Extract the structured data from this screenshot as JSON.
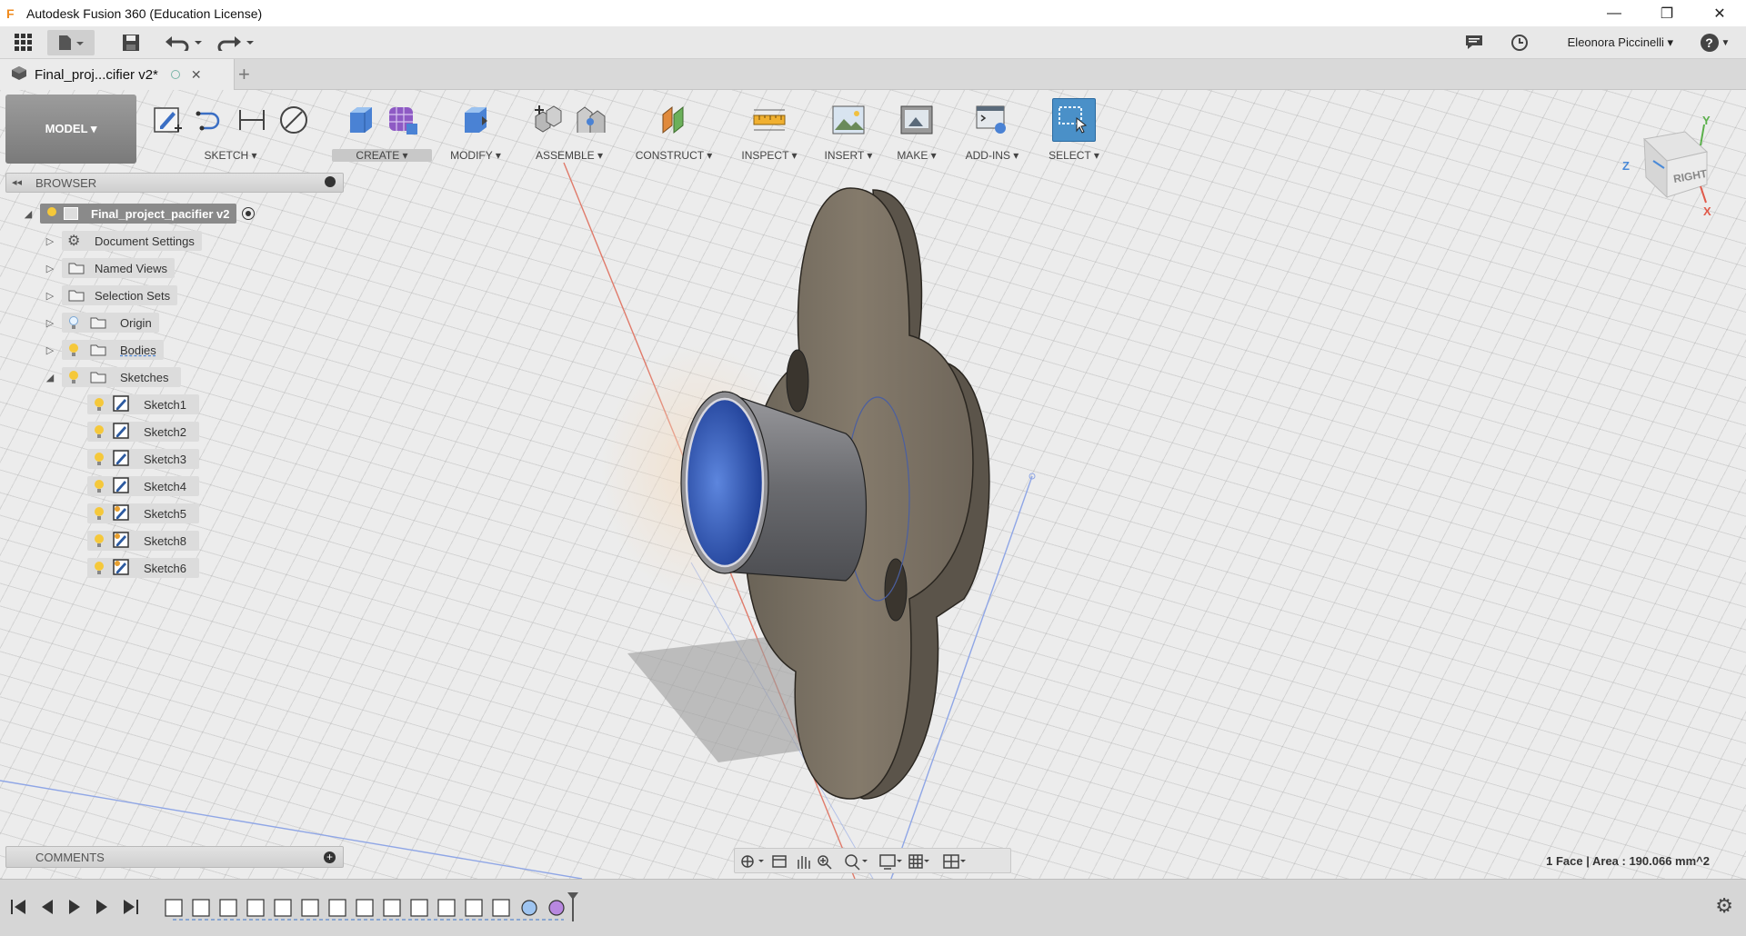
{
  "window": {
    "title": "Autodesk Fusion 360 (Education License)",
    "minimize": "—",
    "maximize": "❐",
    "close": "✕"
  },
  "appbar": {
    "user": "Eleonora Piccinelli ▾",
    "help": "?"
  },
  "doc_tab": {
    "name": "Final_proj...cifier v2*",
    "close": "✕",
    "add": "+"
  },
  "toolbar": {
    "workspace": "MODEL ▾",
    "groups": [
      {
        "label": "SKETCH ▾"
      },
      {
        "label": "CREATE ▾"
      },
      {
        "label": "MODIFY ▾"
      },
      {
        "label": "ASSEMBLE ▾"
      },
      {
        "label": "CONSTRUCT ▾"
      },
      {
        "label": "INSPECT ▾"
      },
      {
        "label": "INSERT ▾"
      },
      {
        "label": "MAKE ▾"
      },
      {
        "label": "ADD-INS ▾"
      },
      {
        "label": "SELECT ▾"
      }
    ]
  },
  "browser": {
    "title": "BROWSER",
    "root": "Final_project_pacifier v2",
    "items": [
      {
        "label": "Document Settings"
      },
      {
        "label": "Named Views"
      },
      {
        "label": "Selection Sets"
      },
      {
        "label": "Origin"
      },
      {
        "label": "Bodies"
      },
      {
        "label": "Sketches"
      }
    ],
    "sketches": [
      {
        "label": "Sketch1"
      },
      {
        "label": "Sketch2"
      },
      {
        "label": "Sketch3"
      },
      {
        "label": "Sketch4"
      },
      {
        "label": "Sketch5"
      },
      {
        "label": "Sketch8"
      },
      {
        "label": "Sketch6"
      }
    ]
  },
  "viewcube": {
    "face": "RIGHT",
    "axis_z": "Z",
    "axis_y": "Y",
    "axis_x": "X"
  },
  "comments": {
    "title": "COMMENTS"
  },
  "status": {
    "text": "1 Face | Area : 190.066 mm^2"
  },
  "colors": {
    "model_body": "#7a7163",
    "cavity": "#2f5bb8",
    "select_active": "#4a90c8"
  }
}
